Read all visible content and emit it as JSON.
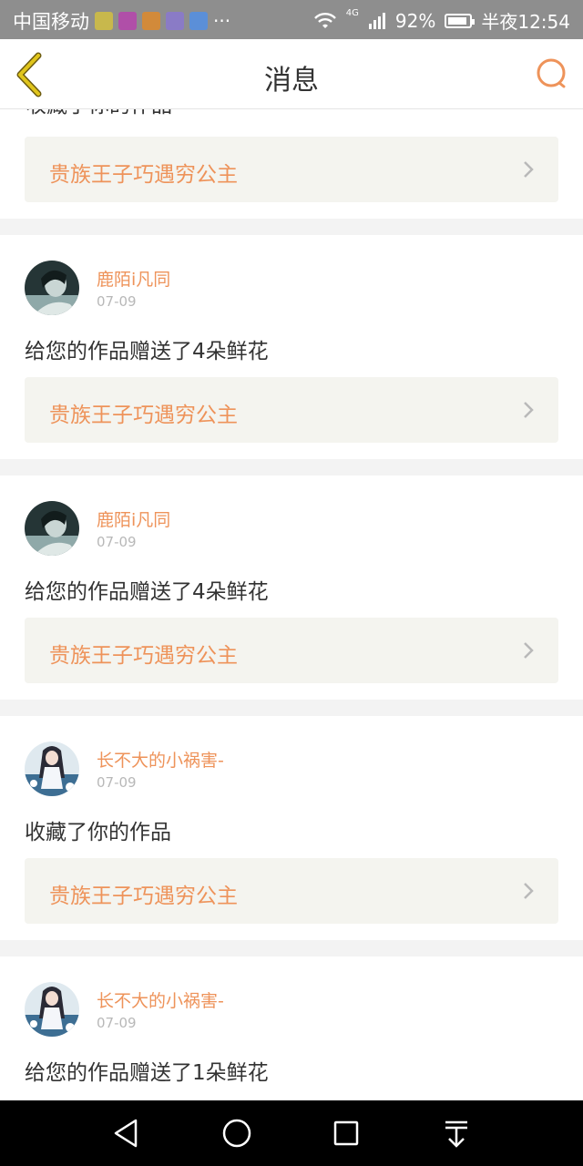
{
  "status_bar": {
    "carrier": "中国移动",
    "more": "···",
    "network": "4G",
    "battery": "92%",
    "time": "半夜12:54",
    "app_icon_colors": [
      "#c8b84c",
      "#b04fa8",
      "#d28a3a",
      "#8a7bc6",
      "#5b8fd8"
    ]
  },
  "header": {
    "title": "消息",
    "accent": "#ee935a",
    "back_color": "#d9c21a"
  },
  "notifications": [
    {
      "user": "",
      "date": "",
      "action": "收藏了你的作品",
      "work": "贵族王子巧遇穷公主",
      "partial": true
    },
    {
      "user": "鹿陌i凡同",
      "date": "07-09",
      "action": "给您的作品赠送了4朵鲜花",
      "work": "贵族王子巧遇穷公主",
      "avatar_icon": "dark-portrait-avatar"
    },
    {
      "user": "鹿陌i凡同",
      "date": "07-09",
      "action": "给您的作品赠送了4朵鲜花",
      "work": "贵族王子巧遇穷公主",
      "avatar_icon": "dark-portrait-avatar"
    },
    {
      "user": "长不大的小祸害-",
      "date": "07-09",
      "action": "收藏了你的作品",
      "work": "贵族王子巧遇穷公主",
      "avatar_icon": "anime-girl-avatar"
    },
    {
      "user": "长不大的小祸害-",
      "date": "07-09",
      "action": "给您的作品赠送了1朵鲜花",
      "work": "",
      "avatar_icon": "anime-girl-avatar"
    }
  ],
  "nav_bar": {
    "buttons": [
      "back-triangle-icon",
      "home-circle-icon",
      "recents-square-icon",
      "notification-pull-icon"
    ]
  }
}
